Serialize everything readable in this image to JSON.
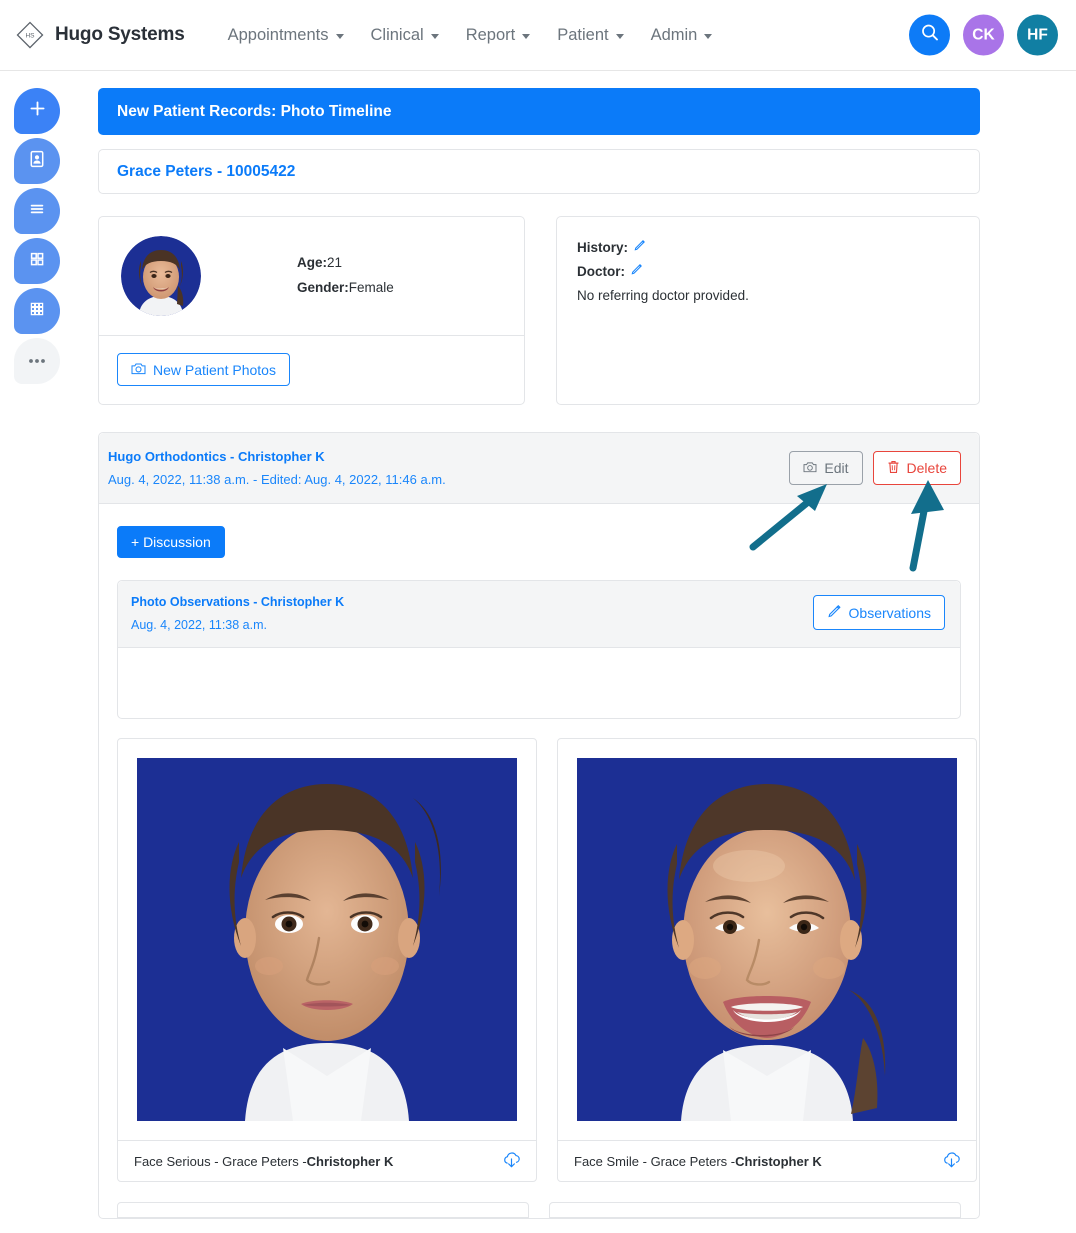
{
  "header": {
    "brand": "Hugo Systems",
    "brand_icon": "hs-diamond-logo",
    "nav": [
      {
        "label": "Appointments",
        "icon": "chevron-down-icon"
      },
      {
        "label": "Clinical",
        "icon": "chevron-down-icon"
      },
      {
        "label": "Report",
        "icon": "chevron-down-icon"
      },
      {
        "label": "Patient",
        "icon": "chevron-down-icon"
      },
      {
        "label": "Admin",
        "icon": "chevron-down-icon"
      }
    ],
    "search_icon": "search-icon",
    "avatars": [
      {
        "initials": "CK",
        "color": "#a974e8"
      },
      {
        "initials": "HF",
        "color": "#117fa3"
      }
    ],
    "colors": {
      "accent": "#0b7bf9",
      "nav_text": "#6c757d"
    }
  },
  "rail": [
    {
      "icon": "plus-icon",
      "color": "#3b82f6"
    },
    {
      "icon": "patient-card-icon",
      "color": "#5b93f0"
    },
    {
      "icon": "list-lines-icon",
      "color": "#5b93f0"
    },
    {
      "icon": "grid-four-icon",
      "color": "#5b93f0"
    },
    {
      "icon": "grid-nine-icon",
      "color": "#5b93f0"
    },
    {
      "icon": "more-dots-icon",
      "color": "#f2f4f6"
    }
  ],
  "banner": {
    "title": "New Patient Records: Photo Timeline"
  },
  "patient_bar": {
    "name": "Grace Peters - 10005422"
  },
  "patient_info": {
    "age_label": "Age:",
    "age_value": "21",
    "gender_label": "Gender:",
    "gender_value": "Female",
    "new_photos_button": "New Patient Photos",
    "new_photos_icon": "camera-icon",
    "history_label": "History:",
    "history_edit_icon": "pencil-icon",
    "doctor_label": "Doctor:",
    "doctor_edit_icon": "pencil-icon",
    "doctor_note": "No referring doctor provided."
  },
  "record": {
    "title": "Hugo Orthodontics - Christopher K",
    "subtitle": "Aug. 4, 2022, 11:38 a.m. - Edited: Aug. 4, 2022, 11:46 a.m.",
    "edit_button": "Edit",
    "edit_icon": "camera-icon",
    "delete_button": "Delete",
    "delete_icon": "trash-icon",
    "discussion_button": "+  Discussion",
    "observations": {
      "title": "Photo Observations - Christopher K",
      "subtitle": "Aug. 4, 2022, 11:38 a.m.",
      "button": "Observations",
      "button_icon": "pencil-icon",
      "body_text": ""
    },
    "photos": [
      {
        "caption_prefix": "Face Serious - Grace Peters -",
        "caption_author": "Christopher K",
        "download_icon": "cloud-download-icon",
        "alt": "front-facing serious portrait on blue background"
      },
      {
        "caption_prefix": "Face Smile - Grace Peters -",
        "caption_author": "Christopher K",
        "download_icon": "cloud-download-icon",
        "alt": "front-facing smiling portrait on blue background"
      }
    ]
  },
  "annotations": {
    "arrow_color": "#126e8c",
    "arrows": [
      {
        "name": "arrow-pointing-to-edit-button"
      },
      {
        "name": "arrow-pointing-to-delete-button"
      }
    ]
  }
}
